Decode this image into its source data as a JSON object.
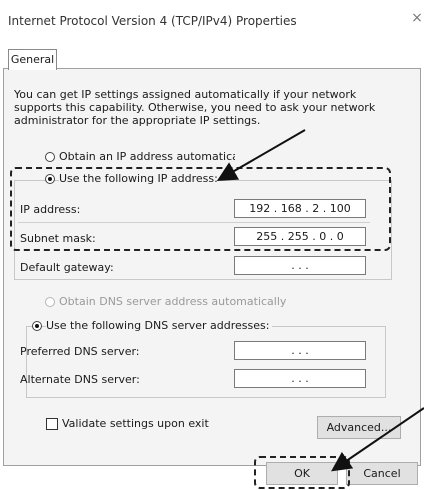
{
  "window": {
    "title": "Internet Protocol Version 4 (TCP/IPv4) Properties",
    "close_icon": "×"
  },
  "tabs": [
    {
      "label": "General"
    }
  ],
  "description": "You can get IP settings assigned automatically if your network supports this capability. Otherwise, you need to ask your network administrator for the appropriate IP settings.",
  "ip_section": {
    "auto_label": "Obtain an IP address automatically",
    "manual_label": "Use the following IP address:",
    "ip_label": "IP address:",
    "ip_value": "192 . 168 .  2  . 100",
    "subnet_label": "Subnet mask:",
    "subnet_value": "255 . 255 .  0  .  0",
    "gateway_label": "Default gateway:",
    "gateway_value": ".       .       ."
  },
  "dns_section": {
    "auto_label": "Obtain DNS server address automatically",
    "manual_label": "Use the following DNS server addresses:",
    "preferred_label": "Preferred DNS server:",
    "preferred_value": ".       .       .",
    "alternate_label": "Alternate DNS server:",
    "alternate_value": ".       .       ."
  },
  "validate_label": "Validate settings upon exit",
  "buttons": {
    "advanced": "Advanced...",
    "ok": "OK",
    "cancel": "Cancel"
  },
  "colors": {
    "window_bg": "#ffffff",
    "panel_bg": "#f4f4f4",
    "annotation": "#222222"
  }
}
